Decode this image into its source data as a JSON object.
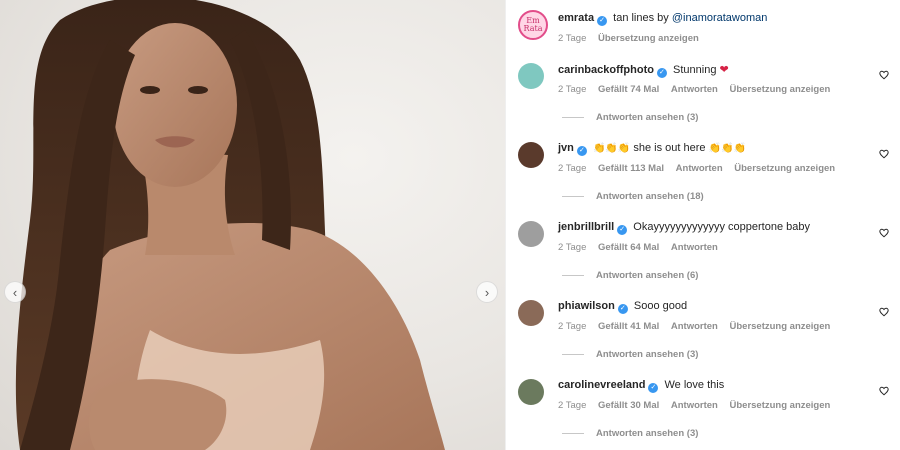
{
  "post": {
    "author": "emrata",
    "avatar_text": "Em Rata",
    "caption_text": "tan lines by ",
    "caption_mention": "@inamoratawoman",
    "time": "2 Tage",
    "translate_label": "Übersetzung anzeigen"
  },
  "labels": {
    "reply": "Antworten",
    "translate": "Übersetzung anzeigen"
  },
  "comments": [
    {
      "username": "carinbackoffphoto",
      "text": "Stunning",
      "time": "2 Tage",
      "likes": "Gefällt 74 Mal",
      "view_replies": "Antworten ansehen (3)",
      "avatar_color": "#7fc8c0"
    },
    {
      "username": "jvn",
      "text_prefix": "👏👏👏",
      "text": "she is out here",
      "text_suffix": "👏👏👏",
      "time": "2 Tage",
      "likes": "Gefällt 113 Mal",
      "view_replies": "Antworten ansehen (18)",
      "avatar_color": "#5a3a2c"
    },
    {
      "username": "jenbrillbrill",
      "text": "Okayyyyyyyyyyyyy coppertone baby",
      "time": "2 Tage",
      "likes": "Gefällt 64 Mal",
      "view_replies": "Antworten ansehen (6)",
      "avatar_color": "#9e9e9e"
    },
    {
      "username": "phiawilson",
      "text": "Sooo good",
      "time": "2 Tage",
      "likes": "Gefällt 41 Mal",
      "view_replies": "Antworten ansehen (3)",
      "avatar_color": "#8a6a58"
    },
    {
      "username": "carolinevreeland",
      "text": "We love this",
      "time": "2 Tage",
      "likes": "Gefällt 30 Mal",
      "view_replies": "Antworten ansehen (3)",
      "avatar_color": "#6b7a5e"
    }
  ],
  "icons": {
    "verified": "verified-badge-icon",
    "heart": "heart-outline-icon",
    "prev": "chevron-left-icon",
    "next": "chevron-right-icon"
  },
  "colors": {
    "verified": "#3897f0",
    "mention": "#00376b",
    "meta": "#8e8e8e"
  }
}
